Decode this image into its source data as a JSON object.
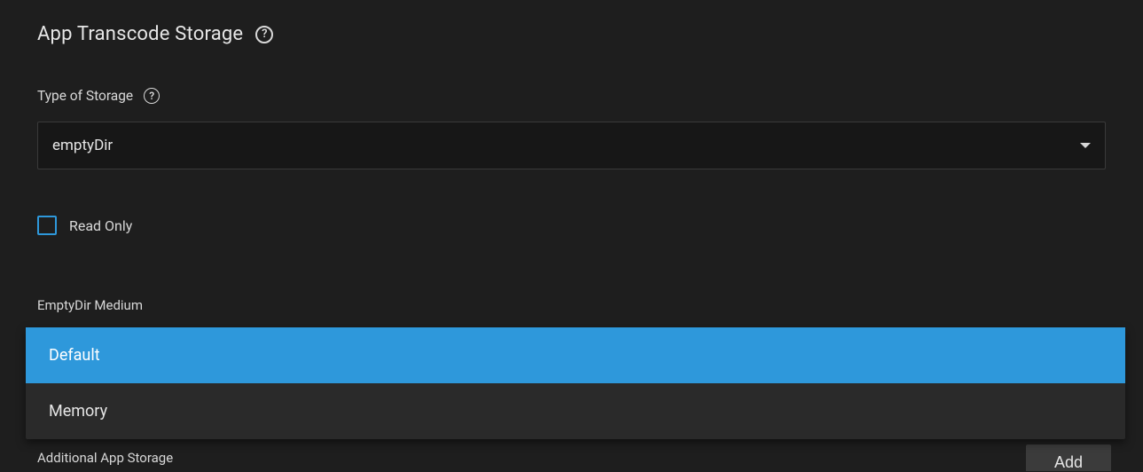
{
  "section": {
    "title": "App Transcode Storage"
  },
  "storage_type": {
    "label": "Type of Storage",
    "value": "emptyDir"
  },
  "read_only": {
    "label": "Read Only",
    "checked": false
  },
  "emptydir_medium": {
    "label": "EmptyDir Medium",
    "options": [
      "Default",
      "Memory"
    ],
    "selected": "Default"
  },
  "additional_storage": {
    "label": "Additional App Storage",
    "add_button": "Add"
  }
}
